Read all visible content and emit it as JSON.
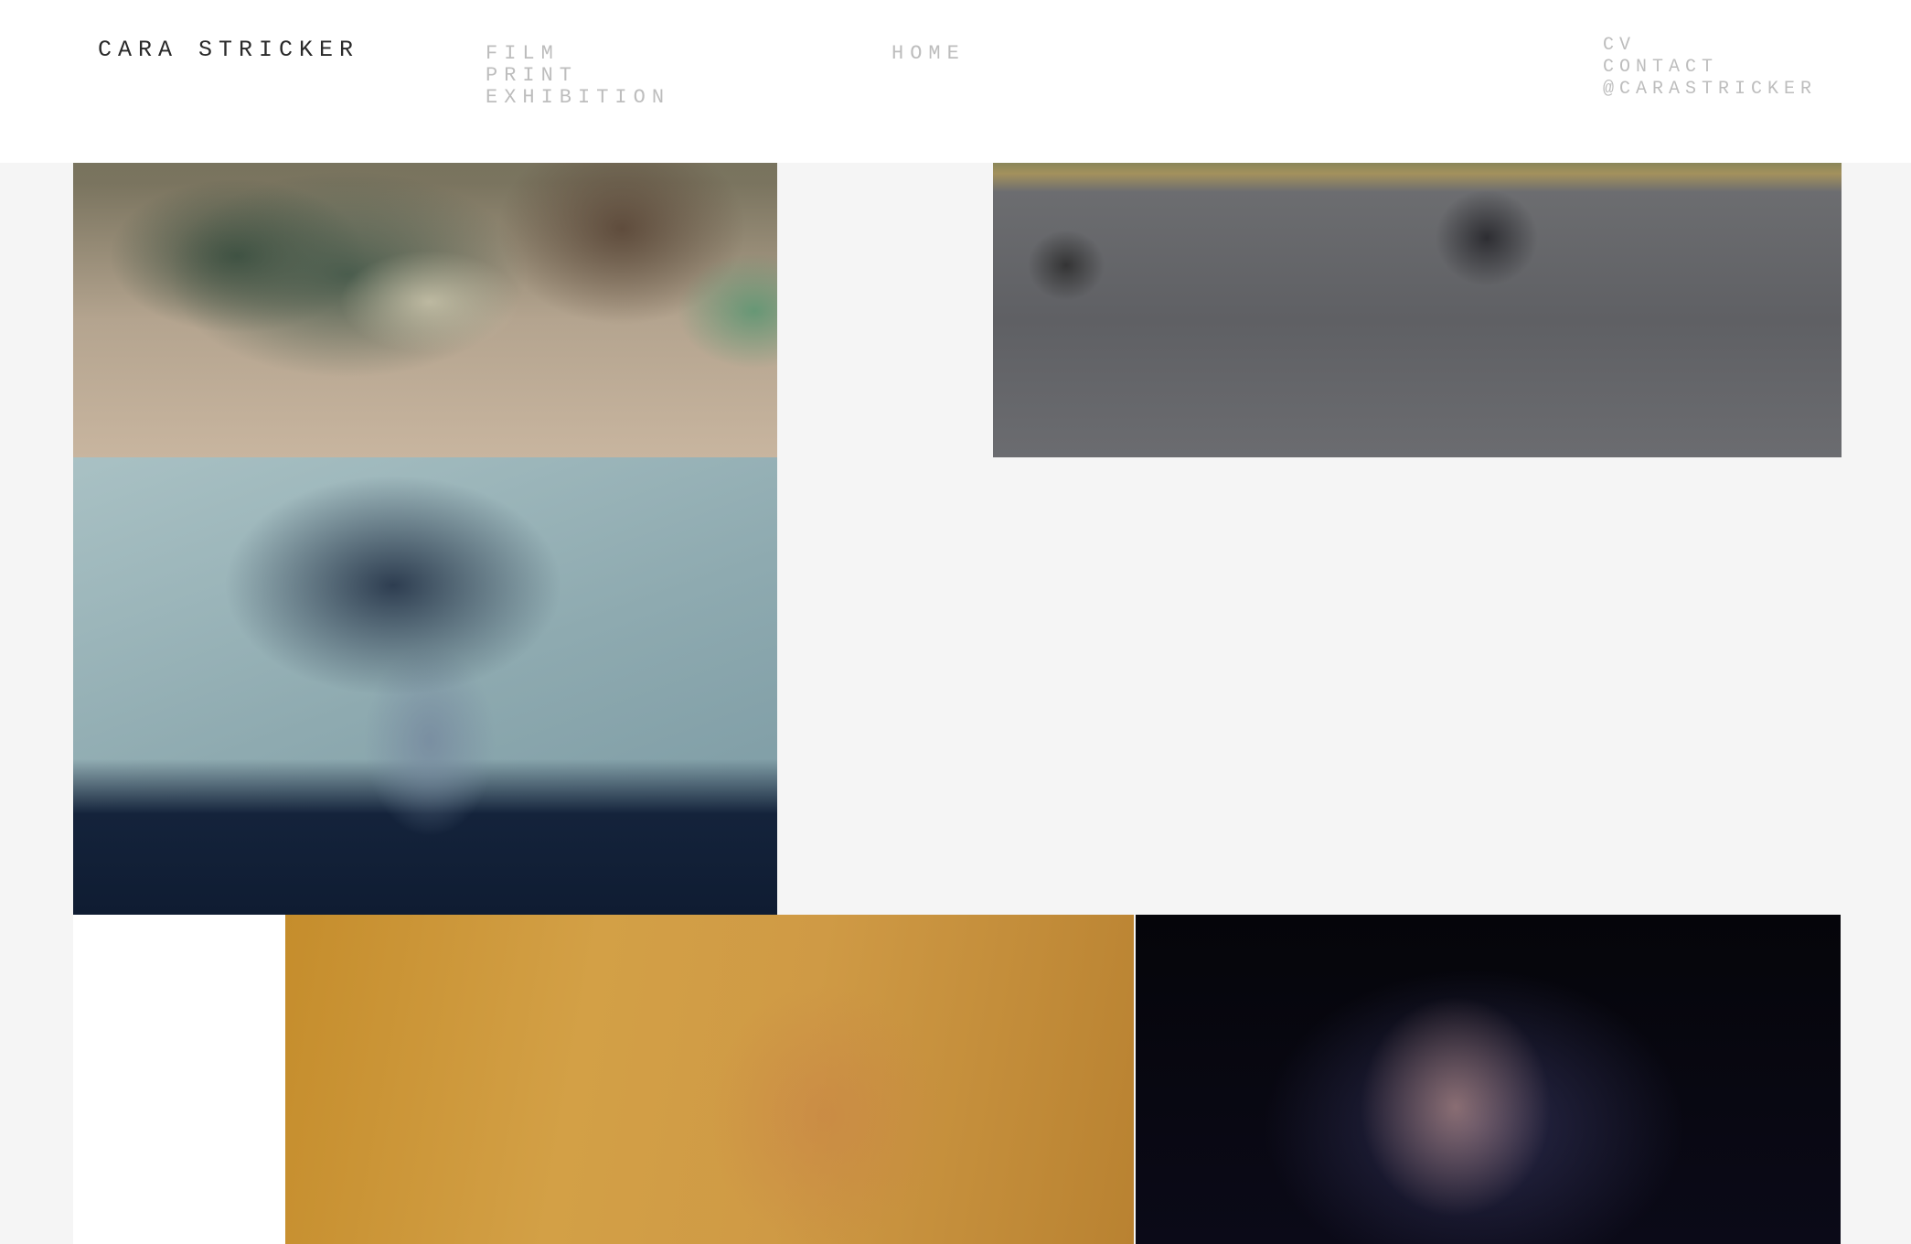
{
  "site": {
    "title": "CARA STRICKER"
  },
  "nav": {
    "work": [
      {
        "label": "FILM"
      },
      {
        "label": "PRINT"
      },
      {
        "label": "EXHIBITION"
      }
    ],
    "home": {
      "label": "HOME"
    },
    "info": [
      {
        "label": "CV"
      },
      {
        "label": "CONTACT"
      },
      {
        "label": "@CARASTRICKER"
      }
    ]
  },
  "gallery": {
    "tiles": [
      {
        "id": "snake"
      },
      {
        "id": "moto"
      },
      {
        "id": "blue"
      },
      {
        "id": "amber"
      },
      {
        "id": "dark"
      }
    ]
  },
  "colors": {
    "header_bg": "#ffffff",
    "page_bg": "#f5f5f5",
    "brand_text": "#2a2a2a",
    "nav_text": "#bdbdbd"
  }
}
